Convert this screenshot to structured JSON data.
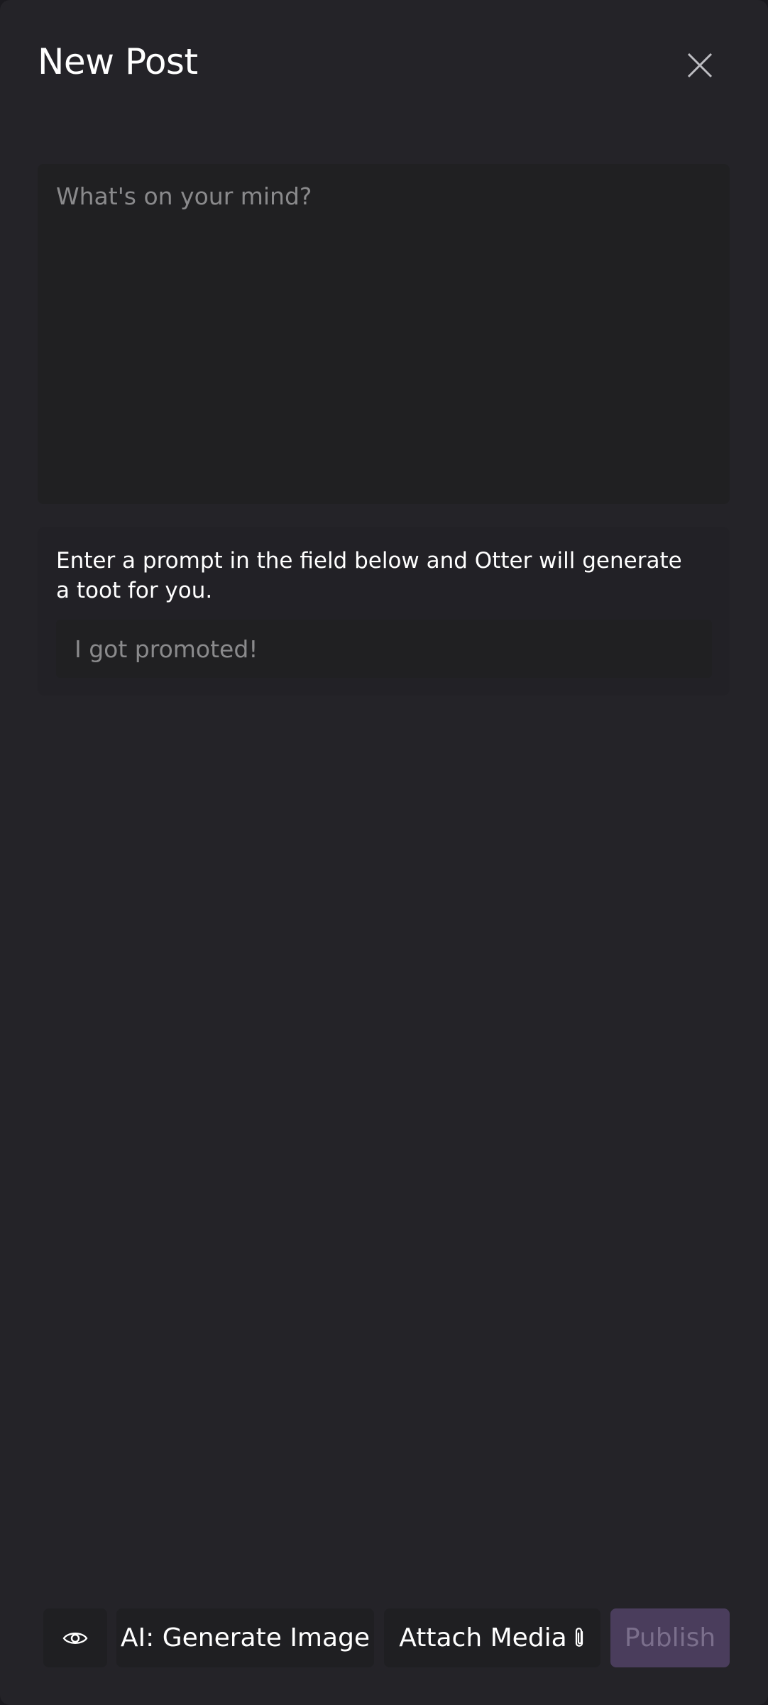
{
  "dialog": {
    "title": "New Post",
    "close_icon": "close-icon"
  },
  "post": {
    "placeholder": "What's on your mind?",
    "value": ""
  },
  "ai_prompt": {
    "description": "Enter a prompt in the field below and Otter will generate a toot for you.",
    "placeholder": "I got promoted!",
    "value": ""
  },
  "toolbar": {
    "preview_icon": "eye-icon",
    "generate_image_label": "AI: Generate Image",
    "attach_media_label": "Attach Media",
    "attach_icon": "paperclip-icon",
    "publish_label": "Publish"
  },
  "colors": {
    "background": "#242328",
    "field": "#202022",
    "publish_disabled_bg": "#4a3d5c",
    "publish_disabled_text": "#7b6f8c"
  }
}
